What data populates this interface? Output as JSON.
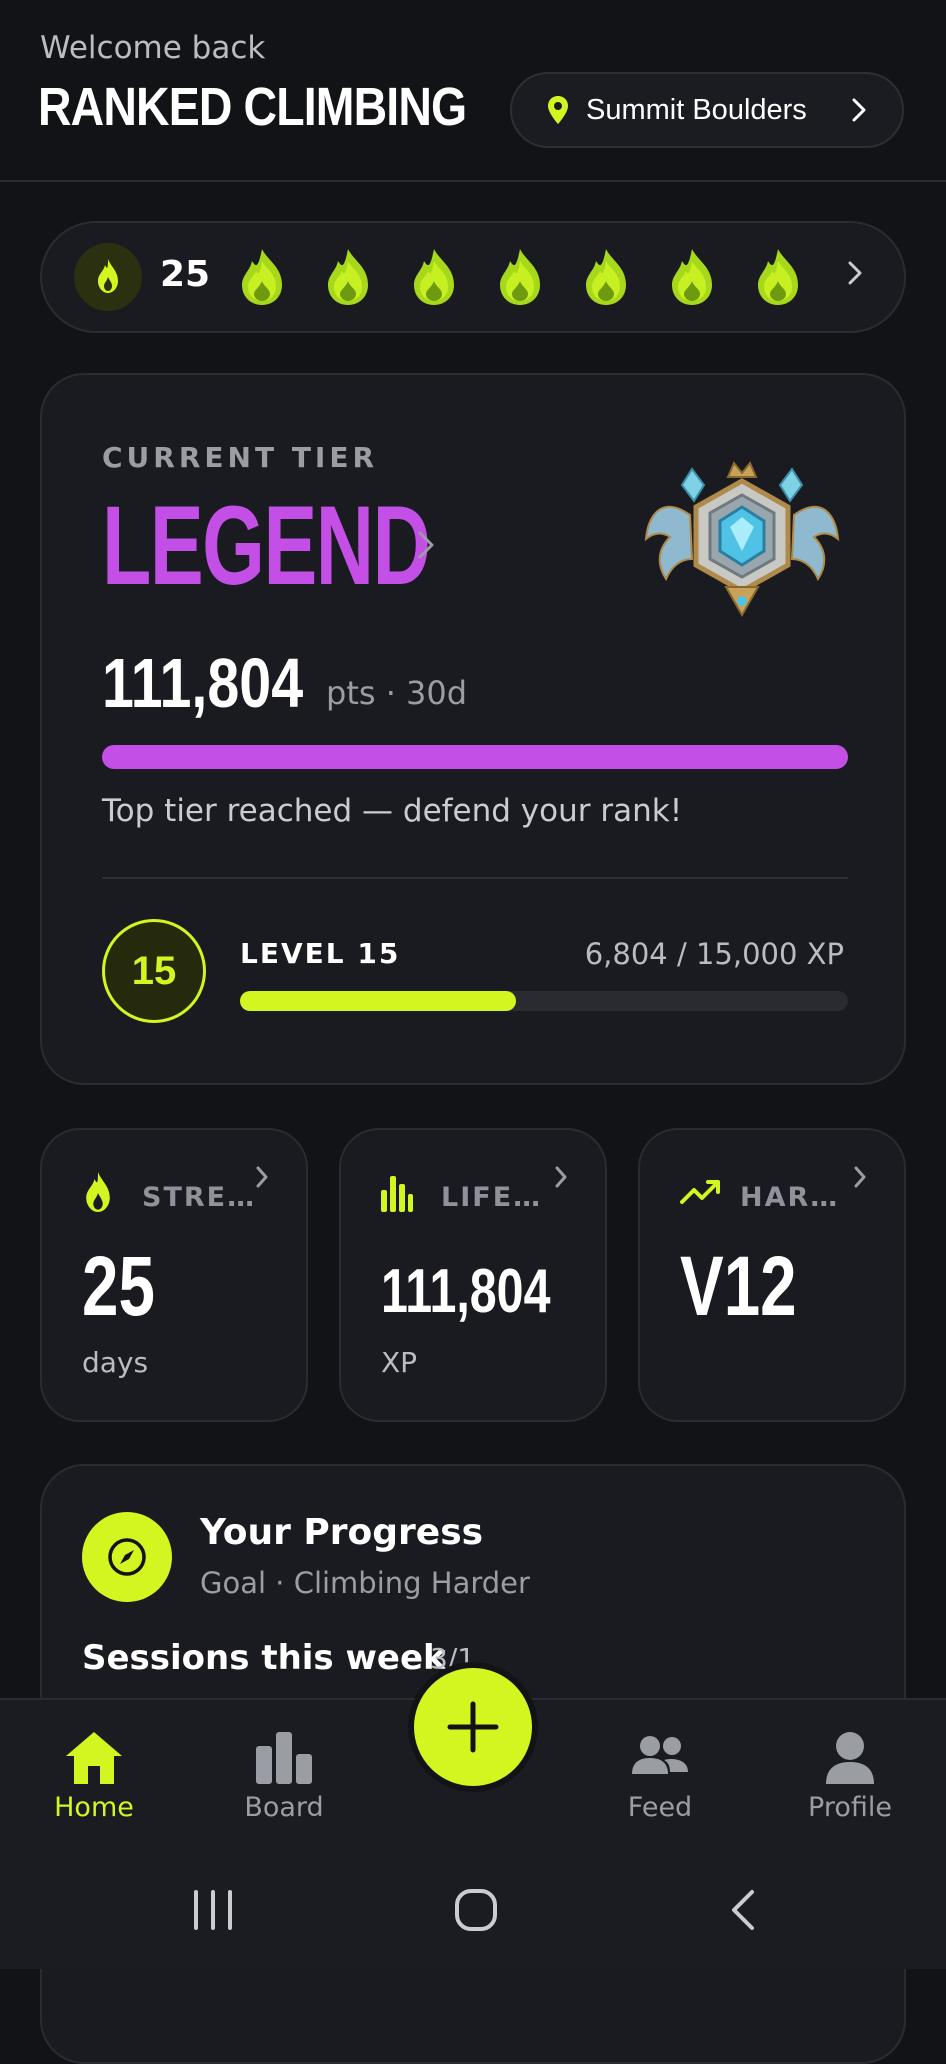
{
  "header": {
    "welcome": "Welcome back",
    "title": "RANKED CLIMBING",
    "gym_name": "Summit Boulders"
  },
  "streak": {
    "count": "25",
    "flames_shown": 7
  },
  "tier": {
    "label": "CURRENT TIER",
    "name": "LEGEND",
    "points": "111,804",
    "points_unit": "pts · 30d",
    "progress_fraction": 1.0,
    "message": "Top tier reached — defend your rank!",
    "level_number": "15",
    "level_label": "LEVEL 15",
    "xp_text": "6,804 / 15,000 XP",
    "xp_fraction": 0.4536
  },
  "stats": [
    {
      "label": "STRE…",
      "value": "25",
      "unit": "days",
      "icon": "flame-icon"
    },
    {
      "label": "LIFE…",
      "value": "111,804",
      "unit": "XP",
      "icon": "bar-chart-icon"
    },
    {
      "label": "HAR…",
      "value": "V12",
      "unit": "",
      "icon": "trending-up-icon"
    }
  ],
  "progress": {
    "title": "Your Progress",
    "subtitle": "Goal · Climbing Harder",
    "sessions_label": "Sessions this week",
    "sessions_count": "3/1"
  },
  "nav": {
    "home": "Home",
    "board": "Board",
    "feed": "Feed",
    "profile": "Profile"
  },
  "colors": {
    "accent": "#d3f520",
    "tier": "#c34fe6",
    "background": "#121317",
    "card": "#1a1b20"
  }
}
